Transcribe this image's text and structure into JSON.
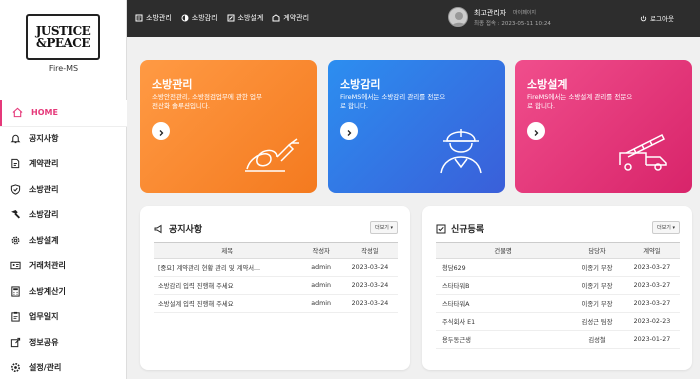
{
  "logo": {
    "line1": "JUSTICE",
    "line2": "&PEACE",
    "subtitle": "Fire-MS"
  },
  "sidebar": {
    "items": [
      {
        "label": "HOME",
        "icon": "home-icon",
        "active": true
      },
      {
        "label": "공지사항",
        "icon": "bell-icon"
      },
      {
        "label": "계약관리",
        "icon": "document-edit-icon"
      },
      {
        "label": "소방관리",
        "icon": "shield-check-icon"
      },
      {
        "label": "소방감리",
        "icon": "hammer-icon"
      },
      {
        "label": "소방설계",
        "icon": "gear-icon"
      },
      {
        "label": "거래처관리",
        "icon": "address-card-icon"
      },
      {
        "label": "소방계산기",
        "icon": "calculator-icon"
      },
      {
        "label": "업무일지",
        "icon": "clipboard-icon"
      },
      {
        "label": "정보공유",
        "icon": "share-icon"
      },
      {
        "label": "설정/관리",
        "icon": "settings-icon"
      }
    ]
  },
  "topnav": {
    "items": [
      {
        "label": "소방관리",
        "icon": "manage-icon"
      },
      {
        "label": "소방감리",
        "icon": "inspect-icon"
      },
      {
        "label": "소방설계",
        "icon": "design-icon"
      },
      {
        "label": "계약관리",
        "icon": "contract-icon"
      }
    ]
  },
  "user": {
    "name": "최고관리자",
    "role": "마이페이지",
    "last_login": "최종 접속 : 2023-05-11 10:24"
  },
  "logout_label": "로그아웃",
  "cards": [
    {
      "title": "소방관리",
      "desc": "소방안전관리, 소방점검업무에 관한 업무전산화 솔루션입니다.",
      "color": "#f47a1f"
    },
    {
      "title": "소방감리",
      "desc": "FireMS에서는 소방감리 관리를 전문으로 합니다.",
      "color": "#2c7be5"
    },
    {
      "title": "소방설계",
      "desc": "FireMS에서는 소방설계 관리를 전문으로 합니다.",
      "color": "#e5397a"
    }
  ],
  "notice": {
    "title": "공지사항",
    "more": "더보기 ▾",
    "headers": [
      "제목",
      "작성자",
      "작성일"
    ],
    "rows": [
      [
        "[중요] 계약관리 현황 관리 및 계약서...",
        "admin",
        "2023-03-24"
      ],
      [
        "소방감리 입력 진행해 주세요",
        "admin",
        "2023-03-24"
      ],
      [
        "소방설계 입력 진행해 주세요",
        "admin",
        "2023-03-24"
      ]
    ]
  },
  "registry": {
    "title": "신규등록",
    "more": "더보기 ▾",
    "headers": [
      "건물명",
      "담당자",
      "계약일"
    ],
    "rows": [
      [
        "청담629",
        "이종기 부장",
        "2023-03-27"
      ],
      [
        "스타타워B",
        "이종기 부장",
        "2023-03-27"
      ],
      [
        "스타타워A",
        "이종기 부장",
        "2023-03-27"
      ],
      [
        "주식회사 E1",
        "김성근 팀장",
        "2023-02-23"
      ],
      [
        "용두동근생",
        "김성철",
        "2023-01-27"
      ]
    ]
  }
}
